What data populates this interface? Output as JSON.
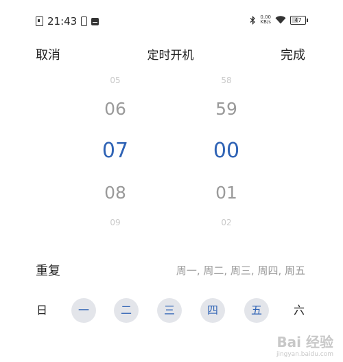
{
  "status_bar": {
    "time": "21:43",
    "net_speed_value": "0.00",
    "net_speed_unit": "KB/s",
    "battery": "47",
    "battery_fraction": 0.47,
    "icons": [
      "sim-icon",
      "phone-icon",
      "message-icon",
      "bluetooth-icon",
      "wifi-icon",
      "battery-icon"
    ]
  },
  "header": {
    "cancel": "取消",
    "title": "定时开机",
    "done": "完成"
  },
  "hour_picker": {
    "items": [
      "05",
      "06",
      "07",
      "08",
      "09"
    ],
    "selected": "07"
  },
  "minute_picker": {
    "items": [
      "58",
      "59",
      "00",
      "01",
      "02"
    ],
    "selected": "00"
  },
  "repeat": {
    "label": "重复",
    "value": "周一, 周二, 周三, 周四, 周五"
  },
  "days": [
    {
      "label": "日",
      "selected": false
    },
    {
      "label": "一",
      "selected": true
    },
    {
      "label": "二",
      "selected": true
    },
    {
      "label": "三",
      "selected": true
    },
    {
      "label": "四",
      "selected": true
    },
    {
      "label": "五",
      "selected": true
    },
    {
      "label": "六",
      "selected": false
    }
  ],
  "watermark": {
    "logo": "Bai 经验",
    "url": "jingyan.baidu.com"
  },
  "colors": {
    "accent": "#2f63b5",
    "day_selected_bg": "#e3e5ea",
    "inactive_text": "#9a9a9a"
  }
}
